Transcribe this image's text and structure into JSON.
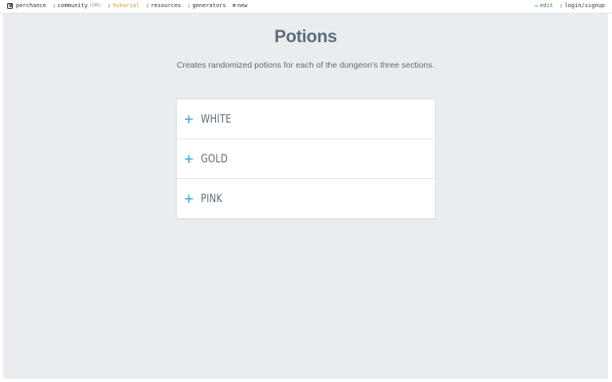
{
  "topbar": {
    "left_items": [
      {
        "label": "perchance",
        "icon": "dice-icon"
      },
      {
        "label": "community",
        "tag": "(145)",
        "icon": "chat-icon"
      },
      {
        "label": "tutorial",
        "icon": "book-icon"
      },
      {
        "label": "resources",
        "icon": "wrench-icon"
      },
      {
        "label": "generators",
        "icon": "list-icon"
      },
      {
        "label": "new",
        "icon": "plus-circle-icon"
      }
    ],
    "right_items": [
      {
        "label": "edit",
        "icon": "pencil-icon"
      },
      {
        "label": "login/signup",
        "icon": "user-icon"
      }
    ]
  },
  "page": {
    "title": "Potions",
    "subtitle": "Creates randomized potions for each of the dungeon's three sections."
  },
  "sections": [
    {
      "label": "WHITE",
      "icon": "plus-icon"
    },
    {
      "label": "GOLD",
      "icon": "plus-icon"
    },
    {
      "label": "PINK",
      "icon": "plus-icon"
    }
  ],
  "colors": {
    "page_background": "#e9edf0",
    "title": "#5c6e7c",
    "accent_plus": "#2b9fd0",
    "tutorial_link": "#e08a1e",
    "edit_link": "#2f8a2f"
  }
}
